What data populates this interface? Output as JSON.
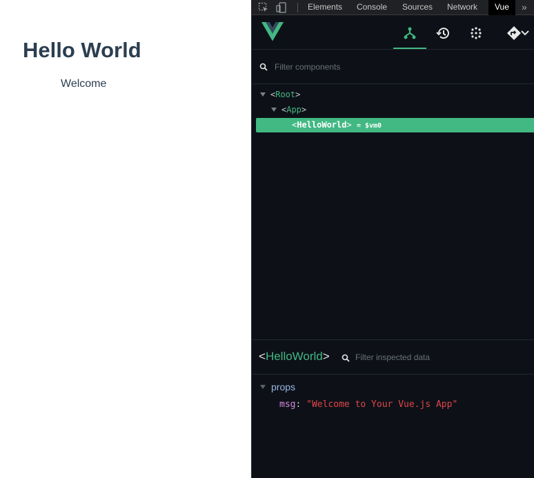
{
  "app": {
    "title": "Hello World",
    "subtitle": "Welcome"
  },
  "devtools": {
    "tabs": [
      "Elements",
      "Console",
      "Sources",
      "Network",
      "Vue"
    ],
    "active_tab": "Vue",
    "more_glyph": "»",
    "icons": [
      "inspect-element-icon",
      "device-toggle-icon",
      "overflow-chevrons-icon"
    ]
  },
  "vue": {
    "toolbar_icons": [
      "vue-logo",
      "components-icon",
      "timeline-icon",
      "performance-icon",
      "routing-icon",
      "chevron-down-icon"
    ],
    "active_tool": "components-icon",
    "filter_placeholder": "Filter components",
    "tree": [
      {
        "open": "<",
        "name": "Root",
        "close": ">",
        "expanded": true
      },
      {
        "open": "<",
        "name": "App",
        "close": ">",
        "expanded": true
      },
      {
        "open": "<",
        "name": "HelloWorld",
        "close": ">",
        "selected": true,
        "vm_ref": "= $vm0"
      }
    ],
    "inspector": {
      "open": "<",
      "component": "HelloWorld",
      "close": ">",
      "filter_placeholder": "Filter inspected data",
      "section": "props",
      "props": [
        {
          "key": "msg",
          "colon": ":",
          "value": "\"Welcome to Your Vue.js App\""
        }
      ]
    }
  },
  "colors": {
    "vue_green": "#42b883",
    "panel_bg": "#0d1117",
    "app_text": "#2c3e50",
    "prop_key": "#d68ae0",
    "prop_string": "#e0464b"
  }
}
